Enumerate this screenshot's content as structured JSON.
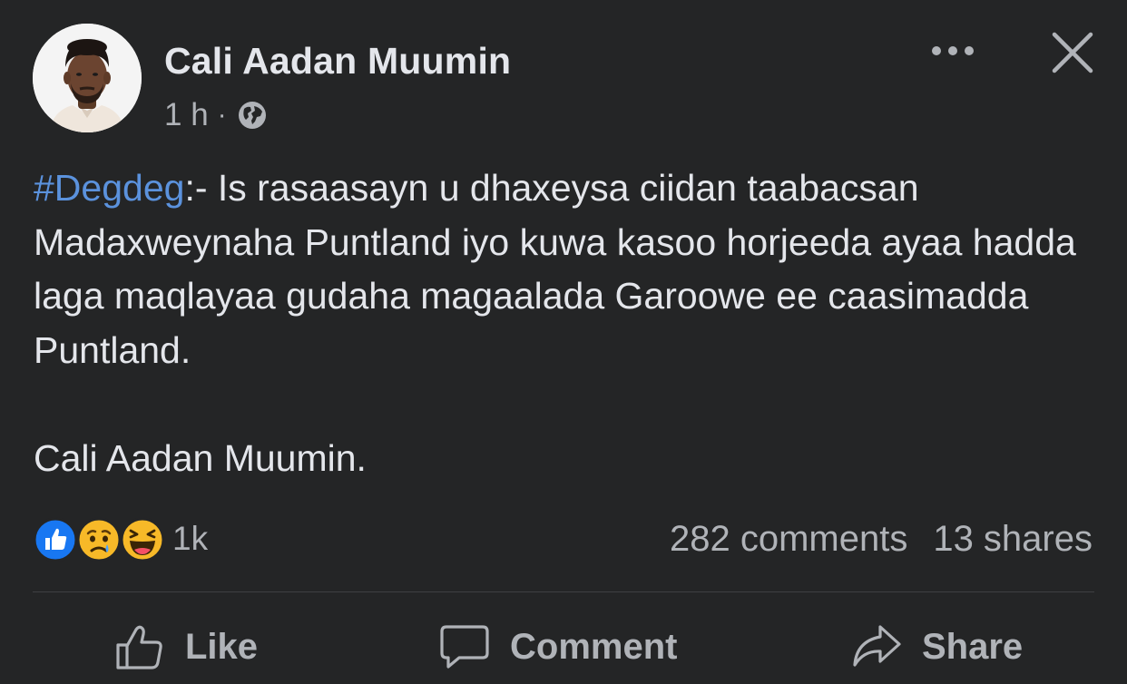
{
  "post": {
    "author_name": "Cali Aadan Muumin",
    "time": "1 h",
    "separator": "·",
    "privacy_icon": "globe-icon",
    "more_icon": "more-horizontal-icon",
    "close_icon": "close-icon",
    "hashtag": "#Degdeg",
    "body_rest": ":- Is rasaasayn u dhaxeysa ciidan taabacsan Madaxweynaha Puntland iyo kuwa kasoo horjeeda ayaa hadda laga maqlayaa gudaha magaalada Garoowe ee caasimadda Puntland.",
    "signature": "Cali Aadan Muumin."
  },
  "stats": {
    "reaction_icons": [
      "like-reaction-icon",
      "sad-reaction-icon",
      "haha-reaction-icon"
    ],
    "reaction_count": "1k",
    "comments": "282 comments",
    "shares": "13 shares"
  },
  "actions": {
    "like_label": "Like",
    "comment_label": "Comment",
    "share_label": "Share"
  },
  "colors": {
    "background": "#242526",
    "text": "#e4e6eb",
    "secondary_text": "#b0b3b8",
    "hashtag": "#5b92dd",
    "like_blue": "#1877f2",
    "emoji_yellow": "#f7b928"
  }
}
